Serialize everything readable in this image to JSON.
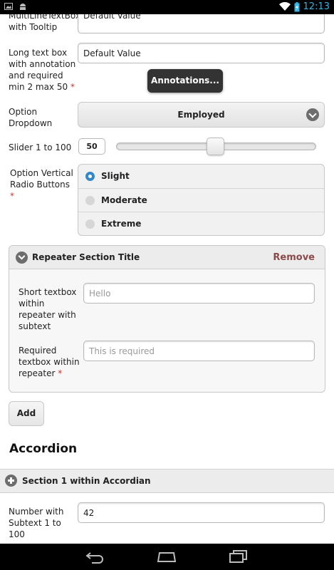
{
  "status_bar": {
    "time": "12:13",
    "icons": [
      "image-icon",
      "android-icon",
      "wifi-icon",
      "battery-charging-icon"
    ]
  },
  "form": {
    "multiline": {
      "label": "MultiLineTextBox with Tooltip",
      "value": "Default Value"
    },
    "long_text": {
      "label": "Long text box with annotation and required min 2 max 50",
      "required_mark": "*",
      "value": "Default Value",
      "tooltip_label": "Annotations..."
    },
    "dropdown": {
      "label": "Option Dropdown",
      "selected": "Employed"
    },
    "slider": {
      "label": "Slider 1 to 100",
      "value": "50",
      "min": 1,
      "max": 100
    },
    "radio": {
      "label": "Option Vertical Radio Buttons",
      "required_mark": "*",
      "options": [
        "Slight",
        "Moderate",
        "Extreme"
      ],
      "selected": "Slight"
    },
    "repeater": {
      "title": "Repeater Section Title",
      "remove_label": "Remove",
      "short_label": "Short textbox within repeater with subtext",
      "short_placeholder": "Hello",
      "required_label": "Required textbox within repeater",
      "required_mark": "*",
      "required_placeholder": "This is required"
    },
    "add_label": "Add"
  },
  "accordion": {
    "title": "Accordion",
    "section1_title": "Section 1 within Accordian",
    "number_label": "Number with Subtext 1 to 100",
    "number_value": "42"
  },
  "colors": {
    "accent": "#3388cc",
    "remove": "#8b4a4a",
    "required": "#c0392b",
    "status_time": "#33b5e5"
  }
}
